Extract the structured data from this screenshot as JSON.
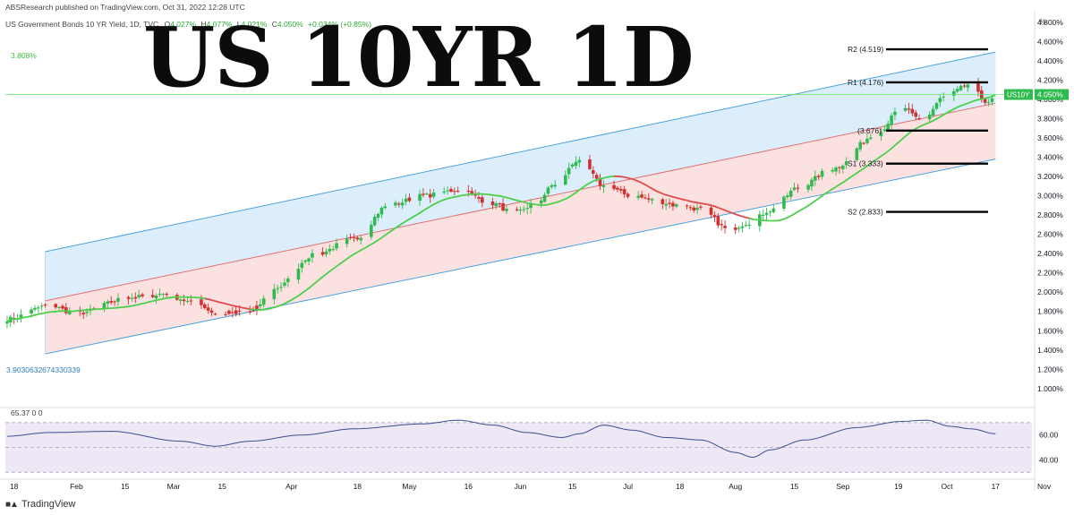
{
  "header": {
    "published": "ABSResearch published on TradingView.com, Oct 31, 2022 12:28 UTC",
    "symbol_line": "US Government Bonds 10 YR Yield, 1D, TVC",
    "ohlc": [
      {
        "label": "O",
        "value": "4.027%"
      },
      {
        "label": "H",
        "value": "4.077%"
      },
      {
        "label": "L",
        "value": "4.021%"
      },
      {
        "label": "C",
        "value": "4.050%"
      }
    ],
    "change": "+0.034% (+0.85%)",
    "overlay_title": "US 10YR 1D",
    "top_left_value": "3.808%",
    "bottom_left_value": "3.9030632674330339",
    "rsi_label": "65.37 0 0"
  },
  "footer": {
    "brand": "TradingView"
  },
  "colors": {
    "up": "#26a69a",
    "up_green": "#2fbb4f",
    "down": "#d32f2f",
    "ma_green": "#4cd04c",
    "ma_red": "#e14b4b",
    "channel_blue": "#4aa3df",
    "channel_red": "#e07070",
    "fill_blue": "#d6ebfb",
    "fill_red": "#fbdada",
    "price_line": "#5de85d",
    "rsi_line": "#3c4f8f",
    "rsi_band": "#ede7f6"
  },
  "chart_data": {
    "type": "candlestick",
    "title": "US 10YR 1D",
    "ylabel": "%",
    "y_unit": "%",
    "ylim": [
      0.85,
      4.9
    ],
    "y_ticks": [
      "4.800%",
      "4.600%",
      "4.400%",
      "4.200%",
      "4.000%",
      "3.800%",
      "3.600%",
      "3.400%",
      "3.200%",
      "3.000%",
      "2.800%",
      "2.600%",
      "2.400%",
      "2.200%",
      "2.000%",
      "1.800%",
      "1.600%",
      "1.400%",
      "1.200%",
      "1.000%"
    ],
    "x_ticks": [
      "18",
      "Feb",
      "15",
      "Mar",
      "15",
      "Apr",
      "18",
      "May",
      "16",
      "Jun",
      "15",
      "Jul",
      "18",
      "Aug",
      "15",
      "Sep",
      "19",
      "Oct",
      "17",
      "Nov"
    ],
    "last_price": {
      "symbol": "US10Y",
      "value": "4.050%"
    },
    "pivots": [
      {
        "label": "R2",
        "value": 4.519
      },
      {
        "label": "R1",
        "value": 4.176
      },
      {
        "label": "",
        "value": 3.676
      },
      {
        "label": "S1",
        "value": 3.333
      },
      {
        "label": "S2",
        "value": 2.833
      }
    ],
    "channel": {
      "start_day": 11,
      "end_day": 285,
      "upper_start": 2.42,
      "upper_end": 4.49,
      "mid_start": 1.91,
      "mid_end": 3.96,
      "lower_start": 1.36,
      "lower_end": 3.38
    },
    "anchors_close": [
      [
        0,
        1.72
      ],
      [
        12,
        1.86
      ],
      [
        20,
        1.78
      ],
      [
        35,
        1.94
      ],
      [
        45,
        1.98
      ],
      [
        55,
        1.88
      ],
      [
        60,
        1.78
      ],
      [
        70,
        1.8
      ],
      [
        78,
        2.05
      ],
      [
        88,
        2.38
      ],
      [
        100,
        2.55
      ],
      [
        110,
        2.9
      ],
      [
        120,
        3.0
      ],
      [
        130,
        3.06
      ],
      [
        140,
        2.92
      ],
      [
        146,
        2.82
      ],
      [
        152,
        2.91
      ],
      [
        158,
        3.12
      ],
      [
        165,
        3.38
      ],
      [
        172,
        3.1
      ],
      [
        180,
        3.0
      ],
      [
        187,
        2.95
      ],
      [
        193,
        2.9
      ],
      [
        200,
        2.86
      ],
      [
        208,
        2.65
      ],
      [
        214,
        2.72
      ],
      [
        220,
        2.85
      ],
      [
        228,
        3.08
      ],
      [
        238,
        3.28
      ],
      [
        250,
        3.62
      ],
      [
        258,
        3.9
      ],
      [
        264,
        3.78
      ],
      [
        270,
        4.02
      ],
      [
        278,
        4.16
      ],
      [
        283,
        3.95
      ],
      [
        285,
        4.05
      ]
    ],
    "ma": {
      "period": 20,
      "style": "green when price above, red when below"
    },
    "rsi": {
      "label": "65.37 0 0",
      "ylim": [
        28,
        80
      ],
      "ticks": [
        "60.00",
        "40.00"
      ],
      "levels": [
        70,
        50,
        30
      ],
      "anchors": [
        [
          0,
          59
        ],
        [
          12,
          62
        ],
        [
          30,
          63
        ],
        [
          50,
          55
        ],
        [
          60,
          51
        ],
        [
          70,
          55
        ],
        [
          85,
          60
        ],
        [
          100,
          65
        ],
        [
          120,
          69
        ],
        [
          130,
          72
        ],
        [
          140,
          68
        ],
        [
          150,
          62
        ],
        [
          160,
          58
        ],
        [
          165,
          61
        ],
        [
          172,
          68
        ],
        [
          180,
          64
        ],
        [
          190,
          58
        ],
        [
          200,
          56
        ],
        [
          210,
          46
        ],
        [
          215,
          42
        ],
        [
          220,
          48
        ],
        [
          230,
          56
        ],
        [
          245,
          66
        ],
        [
          258,
          71
        ],
        [
          265,
          72
        ],
        [
          272,
          67
        ],
        [
          278,
          65
        ],
        [
          285,
          61
        ]
      ]
    }
  }
}
